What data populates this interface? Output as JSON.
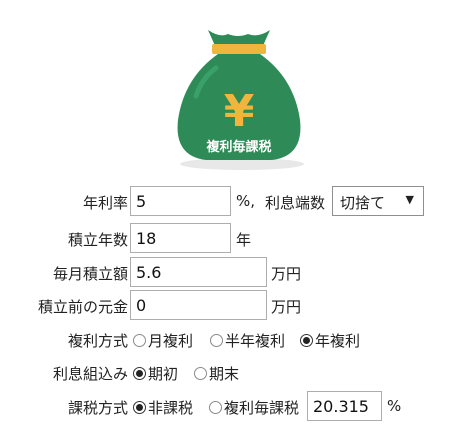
{
  "logo": {
    "currency_symbol": "¥",
    "caption": "複利毎課税"
  },
  "annual_rate": {
    "label": "年利率",
    "value": "5",
    "unit": "%,",
    "rounding_label": "利息端数",
    "rounding_selected": "切捨て"
  },
  "years": {
    "label": "積立年数",
    "value": "18",
    "unit": "年"
  },
  "monthly": {
    "label": "毎月積立額",
    "value": "5.6",
    "unit": "万円"
  },
  "principal": {
    "label": "積立前の元金",
    "value": "0",
    "unit": "万円"
  },
  "compound": {
    "label": "複利方式",
    "options": [
      "月複利",
      "半年複利",
      "年複利"
    ],
    "selected": "年複利"
  },
  "timing": {
    "label": "利息組込み",
    "options": [
      "期初",
      "期末"
    ],
    "selected": "期初"
  },
  "tax": {
    "label": "課税方式",
    "options": [
      "非課税",
      "複利毎課税"
    ],
    "selected": "非課税",
    "rate_value": "20.315",
    "rate_unit": "%"
  },
  "colors": {
    "bag_green": "#2e8b57",
    "bag_highlight": "#3aa06a",
    "band_yellow": "#f0b53c",
    "shadow": "#e8e8e8"
  }
}
